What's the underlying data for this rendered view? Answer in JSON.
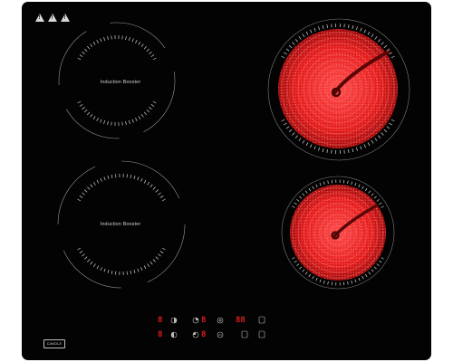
{
  "zones": {
    "top_left": {
      "label": "Induction Booster"
    },
    "bottom_left": {
      "label": "Induction Booster"
    }
  },
  "brand": {
    "label": "CANDLE"
  },
  "display": {
    "digit_1": "8",
    "digit_2": "8",
    "digit_3": "8",
    "digit_4": "88",
    "digit_5": "8",
    "digit_6": "8"
  },
  "icons": {
    "warning": "warning-triangle-icon",
    "booster": "booster-icon",
    "timer": "timer-icon",
    "lock": "lock-icon",
    "power": "power-icon",
    "plus": "plus-icon",
    "minus": "minus-icon"
  },
  "colors": {
    "glass": "#030303",
    "heat_red": "#ff2a2a",
    "display_red": "#e01a1a",
    "marking": "#cfcfcf"
  }
}
